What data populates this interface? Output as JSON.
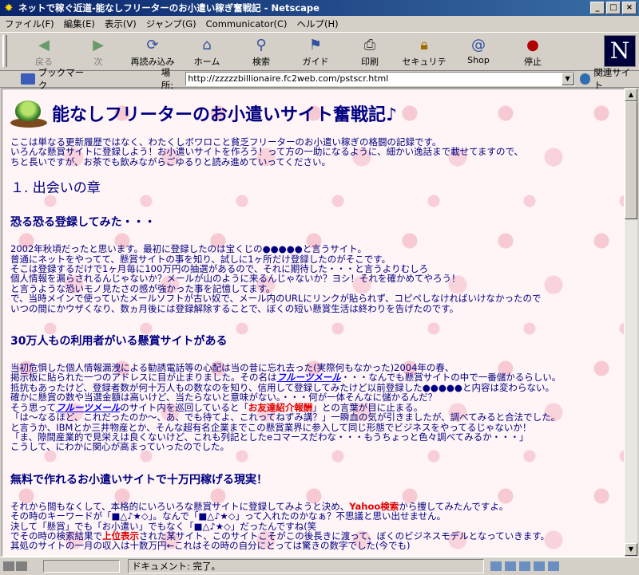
{
  "window": {
    "title": "ネットで稼ぐ近道-能なしフリーターのお小遣い稼ぎ奮戦記 - Netscape",
    "icon": "netscape-star-icon"
  },
  "menu": [
    "ファイル(F)",
    "編集(E)",
    "表示(V)",
    "ジャンプ(G)",
    "Communicator(C)",
    "ヘルプ(H)"
  ],
  "toolbar": {
    "back": "戻る",
    "forward": "次",
    "reload": "再読み込み",
    "home": "ホーム",
    "search": "検索",
    "guide": "ガイド",
    "print": "印刷",
    "security": "セキュリティ",
    "shop": "Shop",
    "stop": "停止"
  },
  "location": {
    "bookmarks": "ブックマーク",
    "label": "場所:",
    "url": "http://zzzzzbillionaire.fc2web.com/pstscr.html",
    "related": "関連サイト"
  },
  "page": {
    "h1": "能なしフリーターのお小遣いサイト奮戦記♪",
    "intro": [
      "ここは単なる更新履歴ではなく、わたくしボワロこと貧乏フリーターのお小遣い稼ぎの格闘の記録です。",
      "いろんな懸賞サイトに登録しよう！お小遣いサイトを作ろう！って方の一助になるように、細かい逸話まで載せてますので、",
      "ちと長いですが、お茶でも飲みながらごゆるりと読み進めていってください。"
    ],
    "chapter1": "１. 出会いの章",
    "s1_title": "恐る恐る登録してみた・・・",
    "s1_lines": [
      "2002年秋頃だったと思います。最初に登録したのは宝くじの●●●●●と言うサイト。",
      "普通にネットをやってて、懸賞サイトの事を知り、試しに1ヶ所だけ登録したのがそこです。",
      "そこは登録するだけで1ヶ月毎に100万円の抽選があるので、それに期待した・・・と言うよりむしろ",
      "個人情報を漏らされるんじゃないか？メールが山のように来るんじゃないか？ヨシ！それを確かめてやろう！",
      "と言うような恐いモノ見たさの感が強かった事を記憶してます。",
      "で、当時メインで使っていたメールソフトが古い奴で、メール内のURLにリンクが貼られず、コピペしなければいけなかったので",
      "いつの間にかウザくなり、数ヵ月後には登録解除することで、ぼくの短い懸賞生活は終わりを告げたのです。"
    ],
    "s2_title": "30万人もの利用者がいる懸賞サイトがある",
    "s2": {
      "l1": "当初危惧した個人情報漏洩による勧誘電話等の心配は当の昔に忘れ去った(実際何もなかった)2004年の春、",
      "l2a": "掲示板に貼られた一つのアドレスに目が止まりました。その名は",
      "link": "フルーツメール",
      "l2b": "・・・なんでも懸賞サイトの中で一番儲かるらしい。",
      "l3": "抵抗もあったけど、登録者数が何十万人もの数なのを知り、信用して登録してみたけど以前登録した●●●●●と内容は変わらない。",
      "l4": "確かに懸賞の数や当選金額は高いけど、当たらないと意味がない。・・・何が一体そんなに儲かるんだ？",
      "l5a": "そう思って",
      "l5b": "のサイト内を巡回していると「",
      "red": "お友達紹介報酬",
      "l5c": "」との言葉が目に止まる。",
      "l6": "「は～なるほど、これだったのか～、あ、でも待てよ、これってねずみ講？」一瞬血の気が引きましたが、調べてみると合法でした。",
      "l7": "と言うか、IBMとか三井物産とか、そんな超有名企業までこの懸賞業界に参入して同じ形態でビジネスをやってるじゃないか！",
      "l8": "「ま、隙間産業的で見栄えは良くないけど、これも列記としたeコマースだわな・・・もうちょっと色々調べてみるか・・・」",
      "l9": "こうして、にわかに関心が高まっていったのでした。"
    },
    "s3_title": "無料で作れるお小遣いサイトで十万円稼げる現実！",
    "s3": {
      "l1a": "それから間もなくして、本格的にいろいろな懸賞サイトに登録してみようと決め、",
      "red1": "Yahoo検索",
      "l1b": "から捜してみたんですよ。",
      "l2": "その時のキーワードが「■△♪★◇」。なんで「■△♪★◇」って入れたのかなぁ？不思議と思い出せません。",
      "l3": "決して「懸賞」でも「お小遣い」でもなく「■△♪★◇」だったんですね(笑",
      "l4a": "でその時の検索結果で",
      "red2": "上位表示",
      "l4b": "された某サイト、このサイトこそがこの後長きに渡って、ぼくのビジネスモデルとなっていきます。",
      "l5": "其処のサイトの一月の収入は十数万円←これはその時の自分にとっては驚きの数字でした(今でも)"
    }
  },
  "status": {
    "text": "ドキュメント: 完了。"
  }
}
